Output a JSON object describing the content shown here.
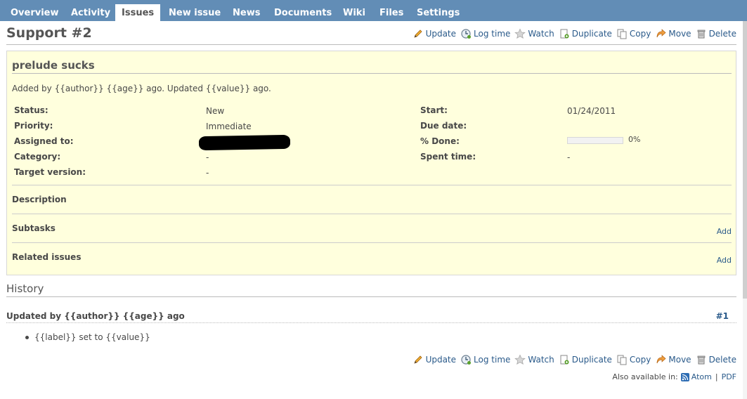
{
  "nav": {
    "tabs": [
      {
        "label": "Overview",
        "selected": false
      },
      {
        "label": "Activity",
        "selected": false
      },
      {
        "label": "Issues",
        "selected": true
      },
      {
        "label": "New issue",
        "selected": false
      },
      {
        "label": "News",
        "selected": false
      },
      {
        "label": "Documents",
        "selected": false
      },
      {
        "label": "Wiki",
        "selected": false
      },
      {
        "label": "Files",
        "selected": false
      },
      {
        "label": "Settings",
        "selected": false
      }
    ]
  },
  "actions": {
    "update": "Update",
    "log_time": "Log time",
    "watch": "Watch",
    "duplicate": "Duplicate",
    "copy": "Copy",
    "move": "Move",
    "delete": "Delete"
  },
  "issue": {
    "title": "Support #2",
    "subject": "prelude sucks",
    "author_line": "Added by {{author}} {{age}} ago. Updated {{value}} ago.",
    "attributes_left": [
      {
        "label": "Status:",
        "value": "New"
      },
      {
        "label": "Priority:",
        "value": "Immediate"
      },
      {
        "label": "Assigned to:",
        "value": ""
      },
      {
        "label": "Category:",
        "value": "-"
      },
      {
        "label": "Target version:",
        "value": "-"
      }
    ],
    "attributes_right": [
      {
        "label": "Start:",
        "value": "01/24/2011"
      },
      {
        "label": "Due date:",
        "value": ""
      },
      {
        "label": "% Done:",
        "value": "0%"
      },
      {
        "label": "Spent time:",
        "value": "-"
      }
    ],
    "done_ratio": 0,
    "description_title": "Description",
    "subtasks_title": "Subtasks",
    "related_title": "Related issues",
    "add_label": "Add"
  },
  "history": {
    "title": "History",
    "journal_header": "Updated by {{author}} {{age}} ago",
    "journal_number": "#1",
    "detail": "{{label}} set to {{value}}"
  },
  "footer": {
    "also_available": "Also available in:",
    "atom": "Atom",
    "separator": "|",
    "pdf": "PDF"
  },
  "colors": {
    "menu_bg": "#628db6",
    "issue_bg": "#ffffdd",
    "link": "#2a5a8a"
  }
}
